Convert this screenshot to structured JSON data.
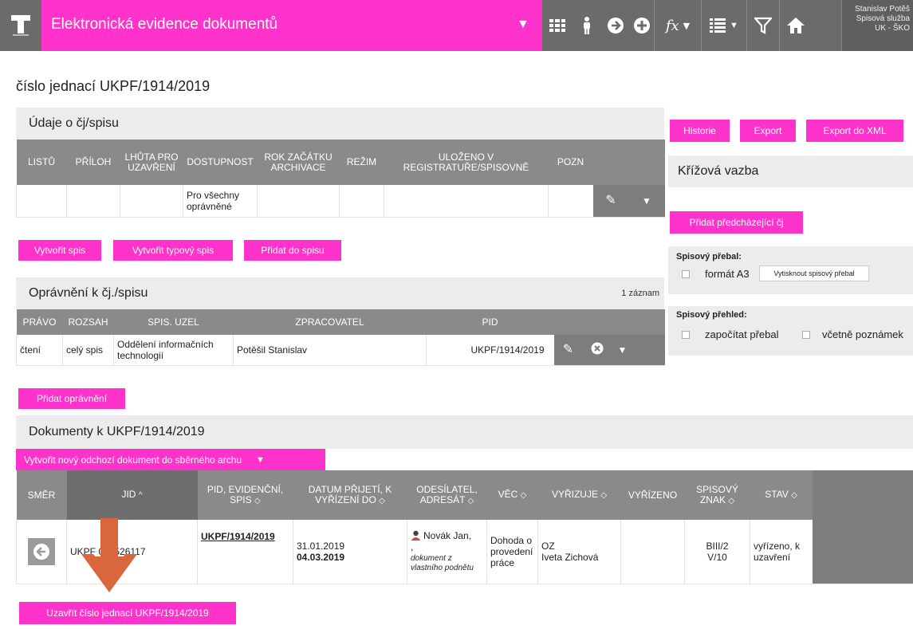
{
  "topbar": {
    "app_title": "Elektronická evidence dokumentů",
    "user_lines": [
      "Stanislav Potěš",
      "Spisová služba",
      "UK - ŠKO"
    ],
    "accent": "#ff33cc",
    "icons": [
      "grid-icon",
      "person-icon",
      "arrow-circle-right-icon",
      "plus-circle-icon",
      "function-icon",
      "list-icon",
      "filter-icon",
      "home-icon"
    ],
    "fx_label": "fx"
  },
  "page_title": "číslo jednací UKPF/1914/2019",
  "udaje": {
    "title": "Údaje o čj/spisu",
    "headers": [
      "LISTŮ",
      "PŘÍLOH",
      "LHŮTA PRO UZAVŘENÍ",
      "DOSTUPNOST",
      "ROK ZAČÁTKU ARCHIVACE",
      "REŽIM",
      "ULOŽENO V REGISTRATUŘE/SPISOVNĚ",
      "POZN"
    ],
    "row": {
      "dostupnost": "Pro všechny oprávněné"
    }
  },
  "buttons": {
    "vytvorit_spis": "Vytvořit spis",
    "vytvorit_typovy": "Vytvořit typový spis",
    "pridat_do_spisu": "Přidat do spisu",
    "pridat_opravneni": "Přidat oprávnění",
    "vytvorit_odchozi": "Vytvořit nový odchozí dokument do sběrného archu",
    "uzavrit": "Uzavřít číslo jednací UKPF/1914/2019",
    "historie": "Historie",
    "export": "Export",
    "export_xml": "Export do XML",
    "pridat_predchazejici": "Přidat předcházející čj"
  },
  "opravneni": {
    "title": "Oprávnění k čj./spisu",
    "count": "1 záznam",
    "headers": [
      "PRÁVO",
      "ROZSAH",
      "SPIS. UZEL",
      "ZPRACOVATEL",
      "PID"
    ],
    "row": {
      "pravo": "čtení",
      "rozsah": "celý spis",
      "uzel": "Oddělení informačních technologií",
      "zpracovatel": "Potěšil Stanislav",
      "pid": "UKPF/1914/2019"
    }
  },
  "dokumenty": {
    "title": "Dokumenty k UKPF/1914/2019",
    "headers": {
      "smer": "SMĚR",
      "jid": "JID",
      "pid": "PID, EVIDENČNÍ, SPIS",
      "datum": "DATUM PŘIJETÍ, K VYŘÍZENÍ DO",
      "odesilatel": "ODESÍLATEL, ADRESÁT",
      "vec": "VĚC",
      "vyrizuje": "VYŘIZUJE",
      "vyrizeno": "VYŘÍZENO",
      "znak": "SPISOVÝ ZNAK",
      "stav": "STAV"
    },
    "row": {
      "jid": "UKPF  000526117",
      "pid": "UKPF/1914/2019",
      "datum_prijeti": "31.01.2019",
      "datum_vyrizeni": "04.03.2019",
      "odesilatel": "Novák Jan,",
      "odesilatel_comma": ",",
      "odesilatel_note": "dokument z vlastního podnětu",
      "vec": "Dohoda o provedení práce",
      "vyrizuje_1": "OZ",
      "vyrizuje_2": "Iveta Zichová",
      "znak_1": "BIII/2",
      "znak_2": "V/10",
      "stav": "vyřízeno, k uzavření"
    }
  },
  "right": {
    "krizova_title": "Křížová vazba",
    "prebal_label": "Spisový přebal:",
    "format_a3": "formát A3",
    "vytisknout": "Vytisknout spisový přebal",
    "prehled_label": "Spisový přehled:",
    "zapocitat": "započítat přebal",
    "vcetne": "včetně poznámek"
  }
}
